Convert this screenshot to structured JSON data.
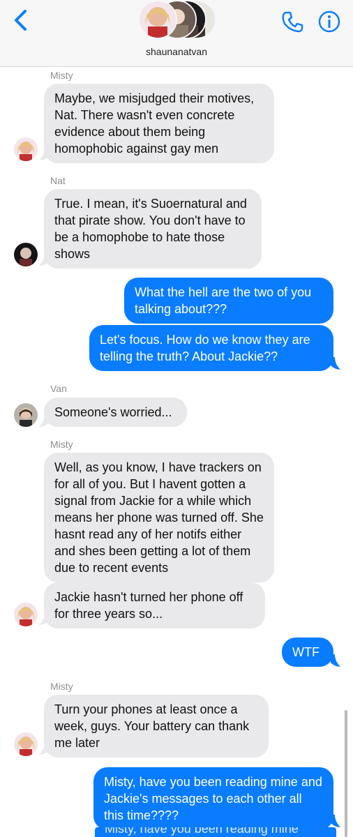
{
  "header": {
    "group_name": "shaunanatvan",
    "back_icon": "chevron-left-icon",
    "call_icon": "phone-icon",
    "info_icon": "info-icon",
    "accent": "#0a7cff"
  },
  "messages": [
    {
      "sender": "Misty",
      "type": "received",
      "text": "Maybe, we misjudged their motives, Nat. There wasn't even concrete evidence about them being homophobic against gay men"
    },
    {
      "sender": "Nat",
      "type": "received",
      "text": "True. I mean, it's Suoernatural and that pirate show. You don't have to be a homophobe to hate those shows"
    },
    {
      "type": "sent",
      "text": "What the hell are the two of you talking about???"
    },
    {
      "type": "sent",
      "text": "Let's focus. How do we know they are telling the truth? About Jackie??"
    },
    {
      "sender": "Van",
      "type": "received",
      "text": "Someone's worried..."
    },
    {
      "sender": "Misty",
      "type": "received",
      "text": "Well, as you know, I have trackers on for all of you. But I havent gotten a signal from Jackie for a while which means her phone was turned off. She hasnt read any of her notifs either and shes been getting a lot of them due to recent events"
    },
    {
      "type": "received",
      "text": "Jackie hasn't turned her phone off for three years so..."
    },
    {
      "type": "sent",
      "text": "WTF"
    },
    {
      "sender": "Misty",
      "type": "received",
      "text": "Turn your phones at least once a week, guys. Your battery can thank me later"
    },
    {
      "type": "sent",
      "text": "Misty, have you been reading mine and Jackie's messages to each other all this time????"
    },
    {
      "type": "sent",
      "text": "Misty, have you been reading mine"
    }
  ],
  "colors": {
    "sent_bubble": "#0a7cff",
    "received_bubble": "#e9e9eb",
    "sender_label": "#8e8e93"
  }
}
